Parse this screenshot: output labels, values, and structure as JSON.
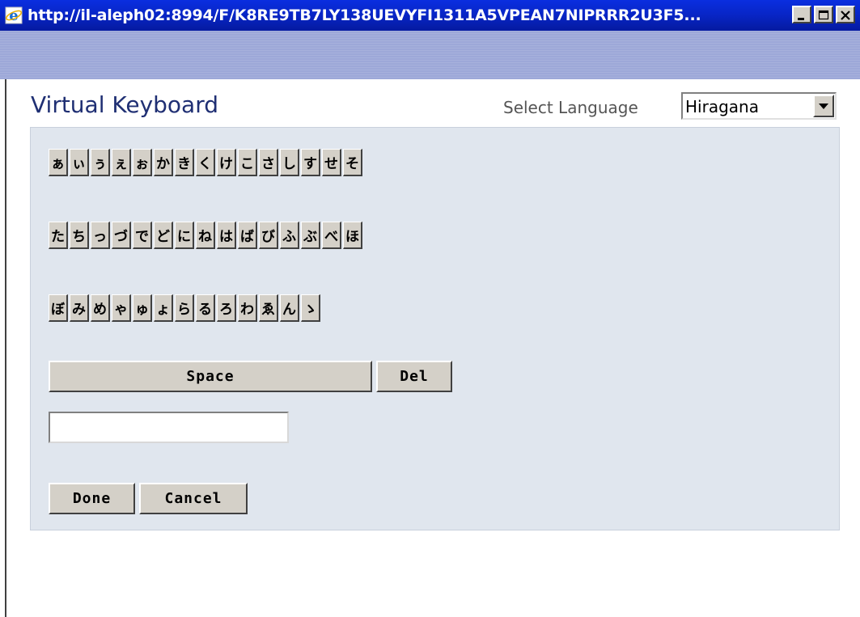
{
  "window": {
    "title": "http://il-aleph02:8994/F/K8RE9TB7LY138UEVYFI1311A5VPEAN7NIPRRR2U3F5...",
    "icon": "internet-explorer-icon",
    "controls": [
      "minimize-icon",
      "maximize-icon",
      "close-icon"
    ]
  },
  "header": {
    "title": "Virtual Keyboard",
    "language_label": "Select Language",
    "language_selected": "Hiragana"
  },
  "keyboard": {
    "row1": [
      "ぁ",
      "ぃ",
      "ぅ",
      "ぇ",
      "ぉ",
      "か",
      "き",
      "く",
      "け",
      "こ",
      "さ",
      "し",
      "す",
      "せ",
      "そ"
    ],
    "row2": [
      "た",
      "ち",
      "っ",
      "づ",
      "で",
      "ど",
      "に",
      "ね",
      "は",
      "ば",
      "び",
      "ふ",
      "ぶ",
      "べ",
      "ほ"
    ],
    "row3": [
      "ぼ",
      "み",
      "め",
      "ゃ",
      "ゅ",
      "ょ",
      "ら",
      "る",
      "ろ",
      "わ",
      "ゑ",
      "ん",
      "ゝ"
    ],
    "space_label": "Space",
    "del_label": "Del"
  },
  "input": {
    "value": ""
  },
  "actions": {
    "done_label": "Done",
    "cancel_label": "Cancel"
  },
  "colors": {
    "titlebar": "#0826c8",
    "bluebar": "#9da8d8",
    "panel": "#e0e6ee",
    "title_text": "#1f2f73",
    "button_face": "#d4d0c8"
  }
}
